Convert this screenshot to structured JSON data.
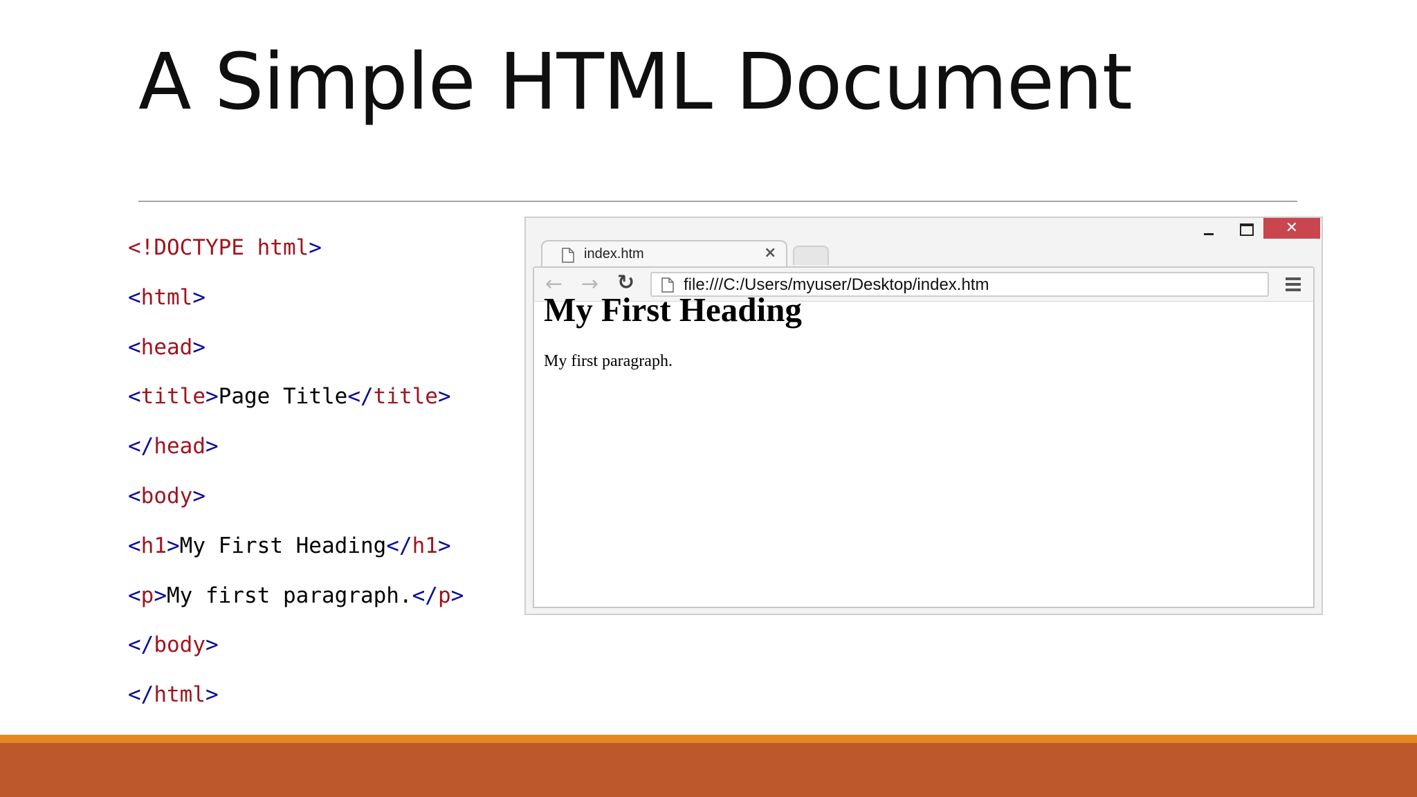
{
  "slide": {
    "title": "A Simple HTML Document"
  },
  "code_lines": [
    [
      {
        "text": "<!DOCTYPE ",
        "color": "r"
      },
      {
        "text": "html",
        "color": "r"
      },
      {
        "text": ">",
        "color": "b"
      }
    ],
    [
      {
        "text": "<",
        "color": "b"
      },
      {
        "text": "html",
        "color": "r"
      },
      {
        "text": ">",
        "color": "b"
      }
    ],
    [
      {
        "text": "<",
        "color": "b"
      },
      {
        "text": "head",
        "color": "r"
      },
      {
        "text": ">",
        "color": "b"
      }
    ],
    [
      {
        "text": "<",
        "color": "b"
      },
      {
        "text": "title",
        "color": "r"
      },
      {
        "text": ">",
        "color": "b"
      },
      {
        "text": "Page Title",
        "color": "t"
      },
      {
        "text": "</",
        "color": "b"
      },
      {
        "text": "title",
        "color": "r"
      },
      {
        "text": ">",
        "color": "b"
      }
    ],
    [
      {
        "text": "</",
        "color": "b"
      },
      {
        "text": "head",
        "color": "r"
      },
      {
        "text": ">",
        "color": "b"
      }
    ],
    [
      {
        "text": "<",
        "color": "b"
      },
      {
        "text": "body",
        "color": "r"
      },
      {
        "text": ">",
        "color": "b"
      }
    ],
    [
      {
        "text": "<",
        "color": "b"
      },
      {
        "text": "h1",
        "color": "r"
      },
      {
        "text": ">",
        "color": "b"
      },
      {
        "text": "My First Heading",
        "color": "t"
      },
      {
        "text": "</",
        "color": "b"
      },
      {
        "text": "h1",
        "color": "r"
      },
      {
        "text": ">",
        "color": "b"
      }
    ],
    [
      {
        "text": "<",
        "color": "b"
      },
      {
        "text": "p",
        "color": "r"
      },
      {
        "text": ">",
        "color": "b"
      },
      {
        "text": "My first paragraph.",
        "color": "t"
      },
      {
        "text": "</",
        "color": "b"
      },
      {
        "text": "p",
        "color": "r"
      },
      {
        "text": ">",
        "color": "b"
      }
    ],
    [
      {
        "text": "</",
        "color": "b"
      },
      {
        "text": "body",
        "color": "r"
      },
      {
        "text": ">",
        "color": "b"
      }
    ],
    [
      {
        "text": "</",
        "color": "b"
      },
      {
        "text": "html",
        "color": "r"
      },
      {
        "text": ">",
        "color": "b"
      }
    ]
  ],
  "browser": {
    "tab_label": "index.htm",
    "tab_close": "×",
    "window_close": "✕",
    "address": "file:///C:/Users/myuser/Desktop/index.htm",
    "page_heading": "My First Heading",
    "page_paragraph": "My first paragraph."
  },
  "colors": {
    "tag_bracket": "#0a0a9a",
    "tag_name": "#a0141e",
    "footer_stripe": "#e3891f",
    "footer_band": "#bd582c",
    "window_close": "#c9464f"
  }
}
